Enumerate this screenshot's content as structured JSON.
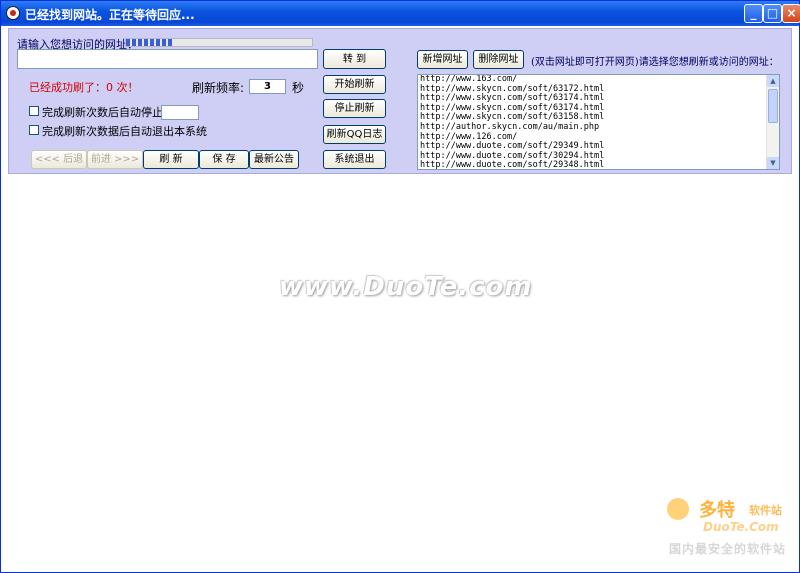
{
  "window": {
    "title": "已经找到网站。正在等待回应...",
    "minimize_glyph": "_",
    "maximize_glyph": "□",
    "close_glyph": "×"
  },
  "panel": {
    "url_prompt": "请输入您想访问的网址：",
    "url_value": "",
    "goto_label": "转  到",
    "success_text": "已经成功刷了：0 次！",
    "freq_label": "刷新频率:",
    "freq_value": "3",
    "freq_unit": "秒",
    "auto_stop_label": "完成刷新次数后自动停止：",
    "auto_stop_value": "",
    "auto_exit_label": "完成刷新次数据后自动退出本系统",
    "back_label": "<<< 后退",
    "forward_label": "前进 >>>",
    "refresh_label": "刷  新",
    "save_label": "保  存",
    "news_label": "最新公告",
    "start_label": "开始刷新",
    "stop_label": "停止刷新",
    "qq_log_label": "刷新QQ日志",
    "exit_label": "系统退出",
    "add_url_label": "新增网址",
    "delete_url_label": "删除网址",
    "list_hint": "(双击网址即可打开网页)请选择您想刷新或访问的网址：",
    "progress_percent": 26
  },
  "url_list": [
    "http://www.163.com/",
    "http://www.skycn.com/soft/63172.html",
    "http://www.skycn.com/soft/63174.html",
    "http://www.skycn.com/soft/63174.html",
    "http://www.skycn.com/soft/63158.html",
    "http://author.skycn.com/au/main.php",
    "http://www.126.com/",
    "http://www.duote.com/soft/29349.html",
    "http://www.duote.com/soft/30294.html",
    "http://www.duote.com/soft/29348.html"
  ],
  "watermark": {
    "center": "www.DuoTe.com",
    "logo_big": "多特",
    "logo_small": "软件站",
    "logo_sub": "DuoTe.Com",
    "logo_bottom": "国内最安全的软件站"
  }
}
